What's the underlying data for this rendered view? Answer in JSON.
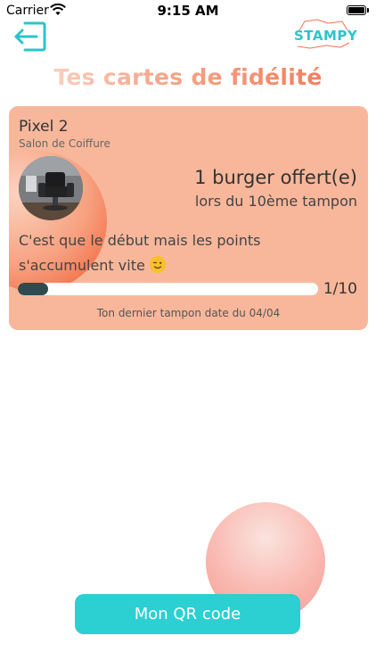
{
  "status_bar": {
    "carrier": "Carrier",
    "time": "9:15 AM"
  },
  "header": {
    "logo_text": "STAMPY",
    "title": "Tes cartes de fidélité"
  },
  "card": {
    "shop_name": "Pixel 2",
    "category": "Salon de Coiffure",
    "reward_title": "1 burger offert(e)",
    "reward_subtitle": "lors du 10ème tampon",
    "message": "C'est que le début mais les points s'accumulent vite",
    "progress": {
      "current": 1,
      "total": 10,
      "label": "1/10"
    },
    "last_stamp": "Ton dernier tampon date du 04/04"
  },
  "actions": {
    "qr_button": "Mon QR code"
  },
  "colors": {
    "accent": "#2ccfd2",
    "card": "#f8b79b",
    "progress": "#2e4b50"
  }
}
